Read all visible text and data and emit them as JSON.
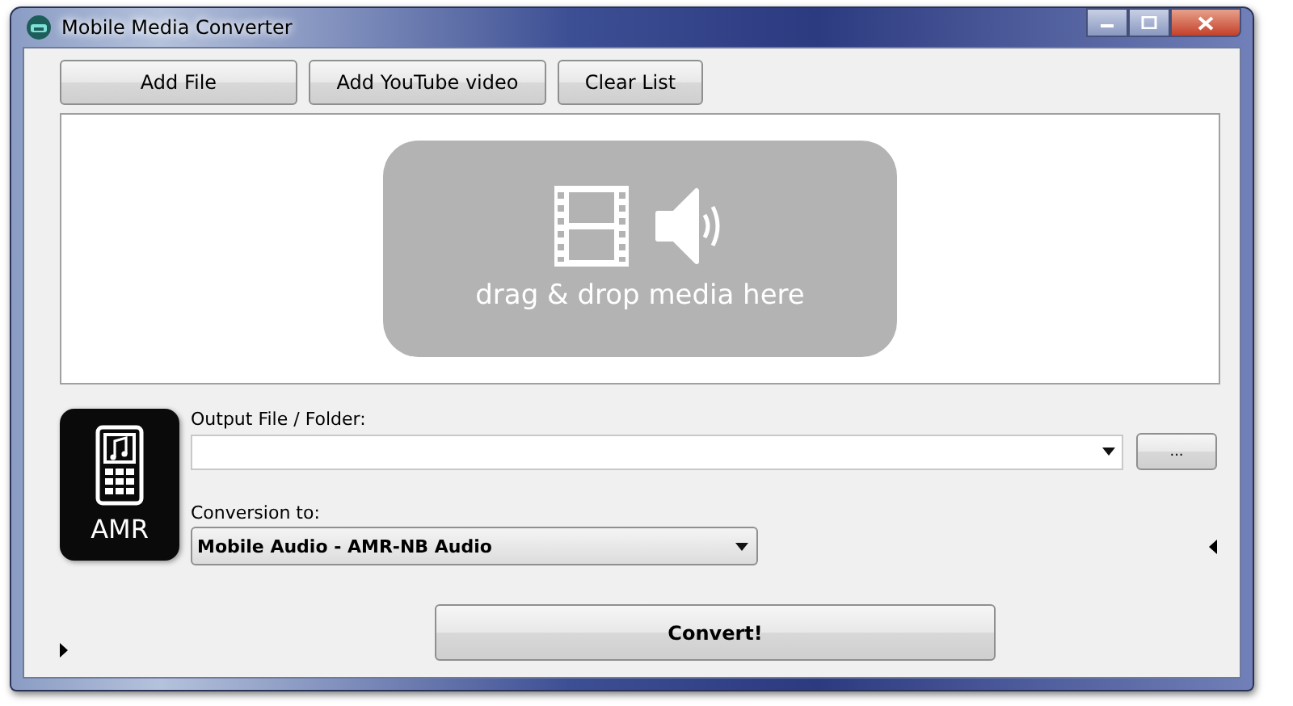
{
  "window": {
    "title": "Mobile Media Converter"
  },
  "toolbar": [
    {
      "label": "Add File"
    },
    {
      "label": "Add YouTube video"
    },
    {
      "label": "Clear List"
    }
  ],
  "drop_zone": {
    "text": "drag & drop media here"
  },
  "format_badge": {
    "label": "AMR"
  },
  "output": {
    "label": "Output File / Folder:",
    "browse_button": "..."
  },
  "conversion": {
    "label": "Conversion to:",
    "value": "Mobile Audio - AMR-NB Audio"
  },
  "convert_button": {
    "label": "Convert!"
  }
}
